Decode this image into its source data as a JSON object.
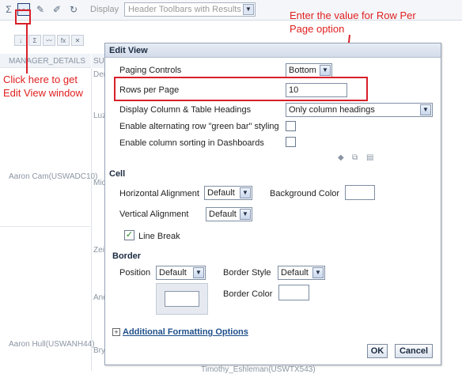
{
  "toolbar": {
    "display_label": "Display",
    "display_value": "Header Toolbars with Results"
  },
  "background_table": {
    "column_header_1": "MANAGER_DETAILS",
    "column_header_2": "SU",
    "managers": [
      "Aaron Cam(USWADC10)",
      "Aaron Hull(USWANH44)"
    ],
    "sub_cells": [
      "Der",
      "Luz",
      "Mic",
      "Zei",
      "And",
      "Bry"
    ],
    "bottom_cell": "Timothy_Eshleman(USWTX543)"
  },
  "annotations": {
    "click_here": "Click here to get Edit View window",
    "enter_value": "Enter the value for Row Per Page option"
  },
  "dialog": {
    "title": "Edit View",
    "paging_controls_label": "Paging Controls",
    "paging_controls_value": "Bottom",
    "rows_per_page_label": "Rows per Page",
    "rows_per_page_value": "10",
    "display_headings_label": "Display Column & Table Headings",
    "display_headings_value": "Only column headings",
    "green_bar_label": "Enable alternating row \"green bar\" styling",
    "column_sorting_label": "Enable column sorting in Dashboards",
    "cell_section": "Cell",
    "horizontal_alignment_label": "Horizontal Alignment",
    "horizontal_alignment_value": "Default",
    "background_color_label": "Background Color",
    "vertical_alignment_label": "Vertical Alignment",
    "vertical_alignment_value": "Default",
    "line_break_label": "Line Break",
    "border_section": "Border",
    "position_label": "Position",
    "position_value": "Default",
    "border_style_label": "Border Style",
    "border_style_value": "Default",
    "border_color_label": "Border Color",
    "additional_options_link": "Additional Formatting Options",
    "ok_label": "OK",
    "cancel_label": "Cancel"
  }
}
